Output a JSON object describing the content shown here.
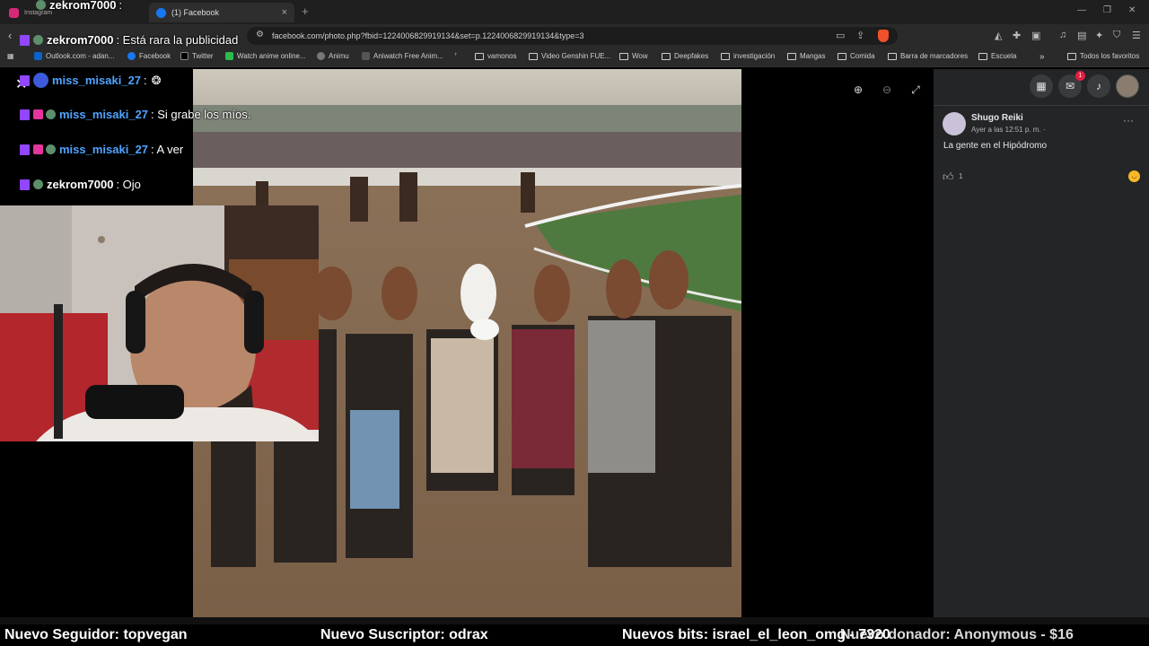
{
  "browser": {
    "tabs": [
      {
        "label": "Instagram"
      },
      {
        "label": "(1) Facebook"
      }
    ],
    "new_tab": "+",
    "url": "facebook.com/photo.php?fbid=1224006829919134&set=p.1224006829919134&type=3",
    "bookmarks": [
      {
        "label": "Outlook.com - adan..."
      },
      {
        "label": "Facebook"
      },
      {
        "label": "Twitter"
      },
      {
        "label": "Watch anime online..."
      },
      {
        "label": "Animu"
      },
      {
        "label": "Aniwatch Free Anim..."
      },
      {
        "label": "vamonos"
      },
      {
        "label": "Video Genshin FUE..."
      },
      {
        "label": "Wow"
      },
      {
        "label": "Deepfakes"
      },
      {
        "label": "investigación"
      },
      {
        "label": "Mangas"
      },
      {
        "label": "Comida"
      },
      {
        "label": "Barra de marcadores"
      },
      {
        "label": "Escuela"
      }
    ],
    "bookmarks_more": "»",
    "all_favorites": "Todos los favoritos"
  },
  "chat": [
    {
      "user": "zekrom7000",
      "message": ": Está rara la publicidad",
      "color": "#ffffff"
    },
    {
      "user": "miss_misaki_27",
      "message": ":",
      "color": "#4fa3ff"
    },
    {
      "user": "miss_misaki_27",
      "message": ": Si grabe los míos.",
      "color": "#4fa3ff"
    },
    {
      "user": "miss_misaki_27",
      "message": ": A ver",
      "color": "#4fa3ff"
    },
    {
      "user": "zekrom7000",
      "message": ": Ojo",
      "color": "#ffffff"
    }
  ],
  "chat_top_partial": {
    "user": "zekrom7000",
    "message": ":"
  },
  "post": {
    "author": "Shugo Reiki",
    "time": "Ayer a las 12:51 p. m. ·",
    "text": "La gente en el Hipódromo",
    "likes": "1"
  },
  "notifications_count": "1",
  "ticker": {
    "follower": "Nuevo Seguidor: topvegan",
    "subscriber": "Nuevo Suscriptor: odrax",
    "bits": "Nuevos bits: israel_el_leon_omg - 7320",
    "donor": "Nuevo donador: Anonymous - $16"
  },
  "colors": {
    "facebook_bg": "#242526",
    "twitch_purple": "#9146ff",
    "username_blue": "#4fa3ff",
    "notification_red": "#e41e3f"
  }
}
